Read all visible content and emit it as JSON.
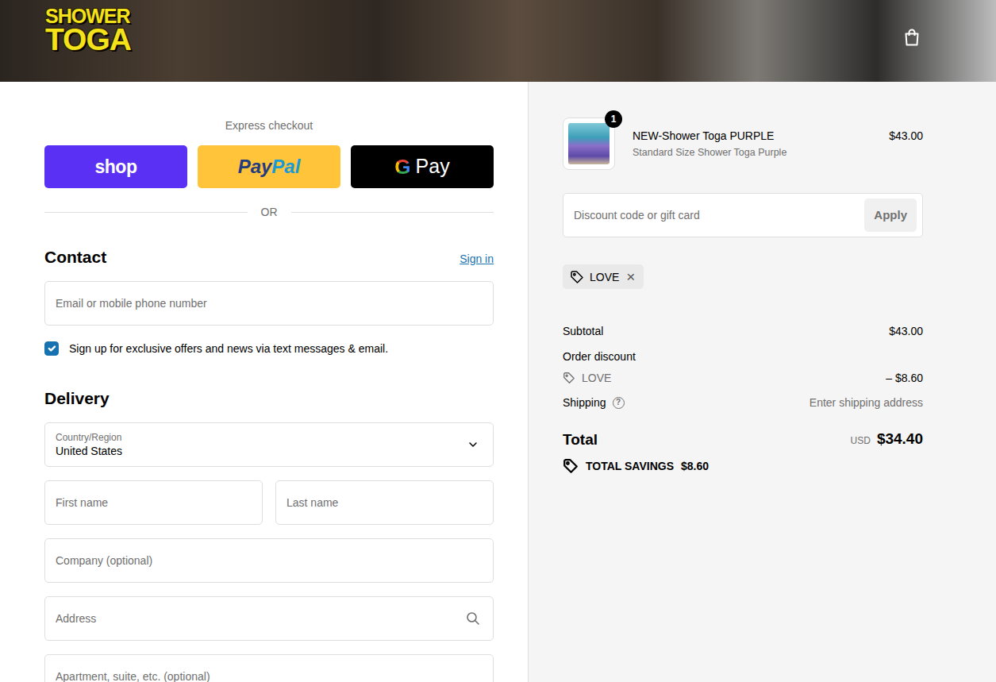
{
  "header": {
    "logo": [
      "SHOWER",
      "TOGA"
    ]
  },
  "express_checkout": {
    "title": "Express checkout",
    "buttons": [
      {
        "kind": "shop",
        "parts": [
          "shop"
        ]
      },
      {
        "kind": "paypal",
        "parts": [
          "Pay",
          "Pal"
        ]
      },
      {
        "kind": "gpay",
        "parts": [
          "G",
          "Pay"
        ]
      }
    ],
    "divider": "OR"
  },
  "contact": {
    "title": "Contact",
    "sign_in": "Sign in",
    "email_placeholder": "Email or mobile phone number",
    "marketing": {
      "label": "Sign up for exclusive offers and news via text messages & email.",
      "checked": true
    }
  },
  "delivery": {
    "title": "Delivery",
    "rows": [
      [
        {
          "kind": "select",
          "label": "Country/Region",
          "value": "United States"
        }
      ],
      [
        {
          "kind": "text",
          "placeholder": "First name"
        },
        {
          "kind": "text",
          "placeholder": "Last name"
        }
      ],
      [
        {
          "kind": "text",
          "placeholder": "Company (optional)"
        }
      ],
      [
        {
          "kind": "search",
          "placeholder": "Address"
        }
      ],
      [
        {
          "kind": "text",
          "placeholder": "Apartment, suite, etc. (optional)"
        }
      ]
    ]
  },
  "summary": {
    "items": [
      {
        "name": "NEW-Shower Toga PURPLE",
        "variant": "Standard Size Shower Toga Purple",
        "price": "$43.00",
        "quantity": "1"
      }
    ],
    "discount": {
      "placeholder": "Discount code or gift card",
      "button": "Apply",
      "disabled": true
    },
    "codes": [
      {
        "code": "LOVE",
        "remove": "×"
      }
    ],
    "subtotal": {
      "label": "Subtotal",
      "value": "$43.00"
    },
    "order_discount": {
      "label": "Order discount",
      "code": "LOVE",
      "value": "– $8.60"
    },
    "shipping": {
      "label": "Shipping",
      "help": "?",
      "value": "Enter shipping address"
    },
    "total": {
      "label": "Total",
      "currency": "USD",
      "value": "$34.40"
    },
    "savings": {
      "label": "TOTAL SAVINGS",
      "value": "$8.60"
    }
  }
}
